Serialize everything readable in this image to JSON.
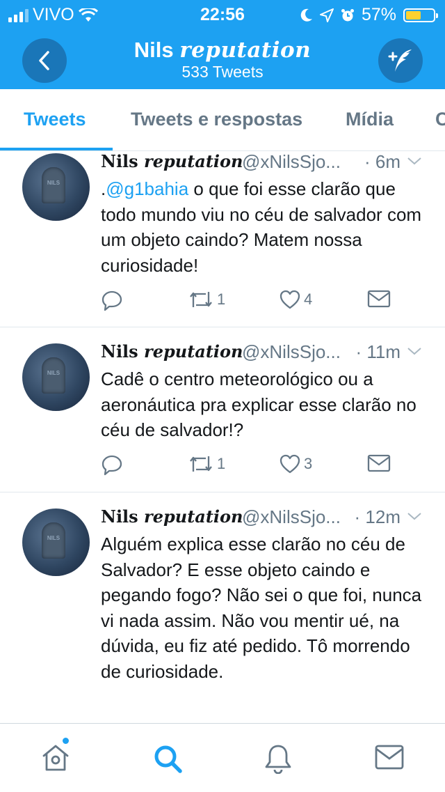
{
  "status_bar": {
    "carrier": "VIVO",
    "time": "22:56",
    "battery": "57%",
    "battery_level": 0.57,
    "icons": [
      "signal-bars-icon",
      "wifi-icon",
      "moon-icon",
      "location-arrow-icon",
      "alarm-icon",
      "battery-icon"
    ]
  },
  "header": {
    "name_plain": "Nils",
    "name_fancy": "reputation",
    "tweet_count": "533 Tweets",
    "back_icon": "chevron-left-icon",
    "compose_icon": "compose-tweet-icon",
    "background": "#1da1f2"
  },
  "tabs": [
    {
      "label": "Tweets",
      "active": true
    },
    {
      "label": "Tweets e respostas",
      "active": false
    },
    {
      "label": "Mídia",
      "active": false
    },
    {
      "label": "C",
      "active": false
    }
  ],
  "tweets": [
    {
      "name_plain": "Nils",
      "name_fancy": "reputation",
      "handle": "@xNilsSjo...",
      "time": "· 6m",
      "mention": "@g1bahia",
      "text_prefix": ".",
      "text": " o que foi esse clarão que todo mundo viu no céu de salvador com um objeto caindo? Matem nossa curiosidade!",
      "retweets": "1",
      "likes": "4"
    },
    {
      "name_plain": "Nils",
      "name_fancy": "reputation",
      "handle": "@xNilsSjo...",
      "time": "· 11m",
      "text": "Cadê o centro meteorológico ou a aeronáutica pra explicar esse clarão no céu de salvador!?",
      "retweets": "1",
      "likes": "3"
    },
    {
      "name_plain": "Nils",
      "name_fancy": "reputation",
      "handle": "@xNilsSjo...",
      "time": "· 12m",
      "text": "Alguém explica esse clarão no céu de Salvador? E esse objeto caindo e pegando fogo? Não sei o que foi, nunca vi nada assim. Não vou mentir ué, na dúvida, eu fiz até pedido. Tô morrendo de curiosidade."
    }
  ],
  "bottom_nav": [
    {
      "icon": "home-icon",
      "active": false,
      "has_dot": true
    },
    {
      "icon": "search-icon",
      "active": true
    },
    {
      "icon": "notifications-bell-icon",
      "active": false
    },
    {
      "icon": "messages-envelope-icon",
      "active": false
    }
  ],
  "colors": {
    "accent": "#1da1f2",
    "text": "#14171a",
    "secondary": "#657786",
    "divider": "#e1e8ed"
  }
}
